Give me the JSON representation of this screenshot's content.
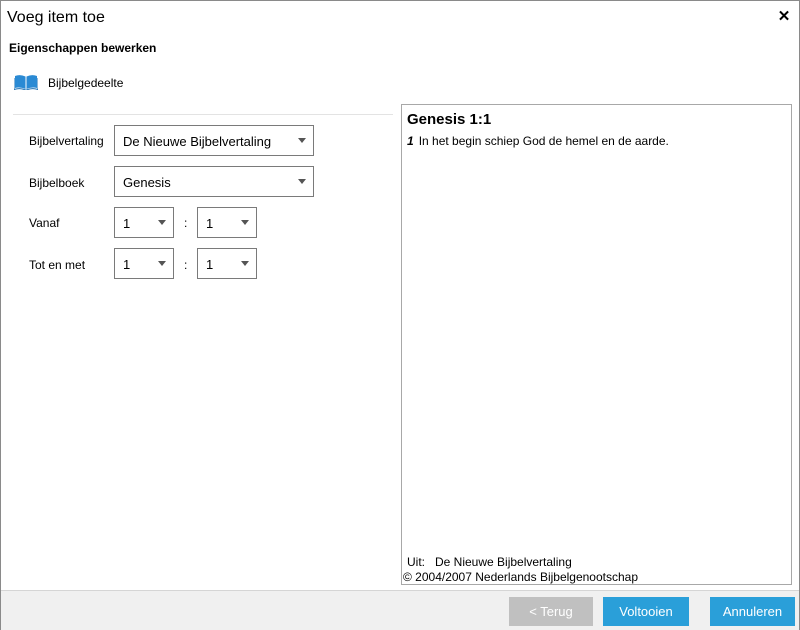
{
  "window": {
    "title": "Voeg item toe"
  },
  "section": {
    "title": "Eigenschappen bewerken"
  },
  "item_type": {
    "icon": "book-icon",
    "label": "Bijbelgedeelte",
    "icon_color": "#2a8ad4"
  },
  "form": {
    "translation": {
      "label": "Bijbelvertaling",
      "value": "De Nieuwe Bijbelvertaling"
    },
    "book": {
      "label": "Bijbelboek",
      "value": "Genesis"
    },
    "from": {
      "label": "Vanaf",
      "chapter": "1",
      "separator": ":",
      "verse": "1"
    },
    "to": {
      "label": "Tot en met",
      "chapter": "1",
      "separator": ":",
      "verse": "1"
    }
  },
  "preview": {
    "reference": "Genesis 1:1",
    "verses": [
      {
        "number": "1",
        "text": "In het begin schiep God de hemel en de aarde."
      }
    ],
    "source": "Uit:   De Nieuwe Bijbelvertaling",
    "copyright": "© 2004/2007 Nederlands Bijbelgenootschap"
  },
  "buttons": {
    "back": "< Terug",
    "finish": "Voltooien",
    "cancel": "Annuleren"
  },
  "colors": {
    "accent": "#2a9fd9",
    "disabled": "#c0c0c0"
  }
}
